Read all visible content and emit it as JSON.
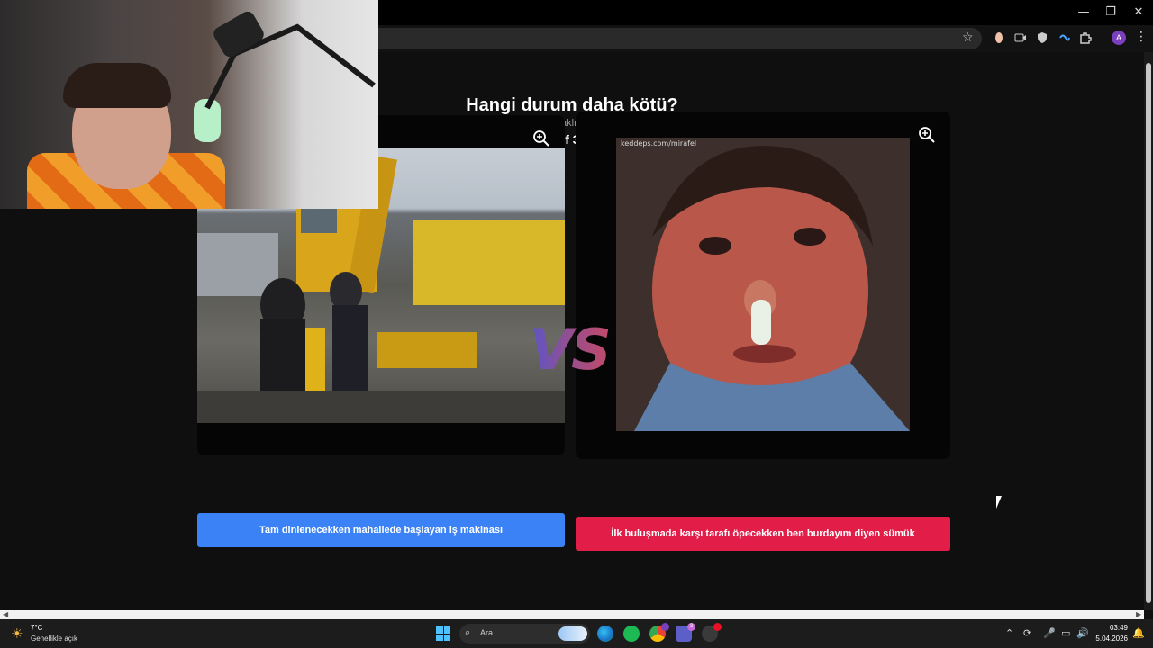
{
  "window": {
    "minimize_glyph": "—",
    "restore_glyph": "❐",
    "close_glyph": "✕"
  },
  "browser": {
    "bookmark_icon": "star-icon",
    "profile_initial": "A",
    "menu_glyph": "⋮"
  },
  "page": {
    "title": "Hangi durum daha kötü?",
    "subtitle": "Yaşanan kötü aksaklıkları birde siz seçin",
    "round": "Rounds of 32 Match 5",
    "vs": "VS",
    "left": {
      "button_label": "Tam dinlenecekken mahallede başlayan iş makinası",
      "button_color": "#3b82f6"
    },
    "right": {
      "button_label": "İlk buluşmada karşı tarafı öpecekken ben burdayım diyen sümük",
      "button_color": "#e11d48",
      "watermark": "keddeps.com/mirafel"
    }
  },
  "taskbar": {
    "weather_temp": "7°C",
    "weather_desc": "Genellikle açık",
    "search_placeholder": "Ara",
    "notification_badge_1": "3",
    "time": "03:49",
    "date": "5.04.2026"
  }
}
